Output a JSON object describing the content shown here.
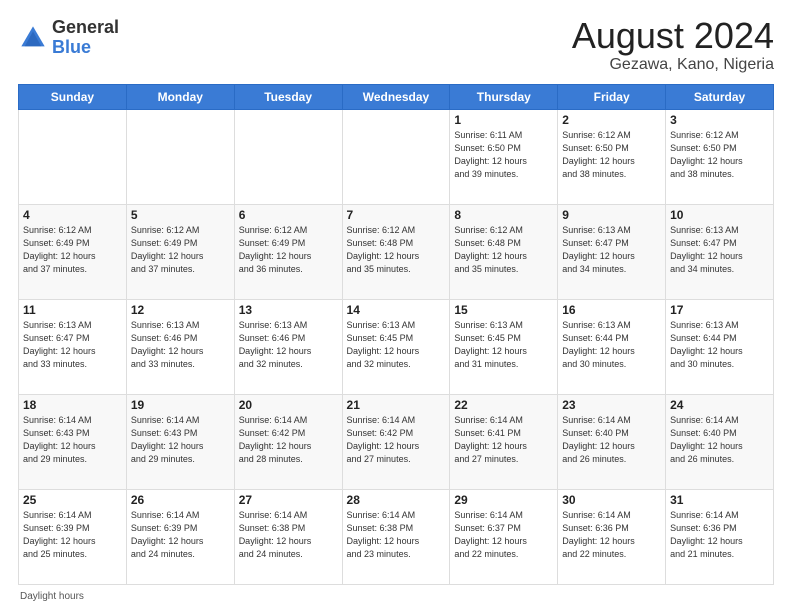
{
  "header": {
    "logo_general": "General",
    "logo_blue": "Blue",
    "month_title": "August 2024",
    "location": "Gezawa, Kano, Nigeria"
  },
  "days_of_week": [
    "Sunday",
    "Monday",
    "Tuesday",
    "Wednesday",
    "Thursday",
    "Friday",
    "Saturday"
  ],
  "footer": {
    "daylight_label": "Daylight hours"
  },
  "weeks": [
    [
      {
        "day": "",
        "info": ""
      },
      {
        "day": "",
        "info": ""
      },
      {
        "day": "",
        "info": ""
      },
      {
        "day": "",
        "info": ""
      },
      {
        "day": "1",
        "info": "Sunrise: 6:11 AM\nSunset: 6:50 PM\nDaylight: 12 hours\nand 39 minutes."
      },
      {
        "day": "2",
        "info": "Sunrise: 6:12 AM\nSunset: 6:50 PM\nDaylight: 12 hours\nand 38 minutes."
      },
      {
        "day": "3",
        "info": "Sunrise: 6:12 AM\nSunset: 6:50 PM\nDaylight: 12 hours\nand 38 minutes."
      }
    ],
    [
      {
        "day": "4",
        "info": "Sunrise: 6:12 AM\nSunset: 6:49 PM\nDaylight: 12 hours\nand 37 minutes."
      },
      {
        "day": "5",
        "info": "Sunrise: 6:12 AM\nSunset: 6:49 PM\nDaylight: 12 hours\nand 37 minutes."
      },
      {
        "day": "6",
        "info": "Sunrise: 6:12 AM\nSunset: 6:49 PM\nDaylight: 12 hours\nand 36 minutes."
      },
      {
        "day": "7",
        "info": "Sunrise: 6:12 AM\nSunset: 6:48 PM\nDaylight: 12 hours\nand 35 minutes."
      },
      {
        "day": "8",
        "info": "Sunrise: 6:12 AM\nSunset: 6:48 PM\nDaylight: 12 hours\nand 35 minutes."
      },
      {
        "day": "9",
        "info": "Sunrise: 6:13 AM\nSunset: 6:47 PM\nDaylight: 12 hours\nand 34 minutes."
      },
      {
        "day": "10",
        "info": "Sunrise: 6:13 AM\nSunset: 6:47 PM\nDaylight: 12 hours\nand 34 minutes."
      }
    ],
    [
      {
        "day": "11",
        "info": "Sunrise: 6:13 AM\nSunset: 6:47 PM\nDaylight: 12 hours\nand 33 minutes."
      },
      {
        "day": "12",
        "info": "Sunrise: 6:13 AM\nSunset: 6:46 PM\nDaylight: 12 hours\nand 33 minutes."
      },
      {
        "day": "13",
        "info": "Sunrise: 6:13 AM\nSunset: 6:46 PM\nDaylight: 12 hours\nand 32 minutes."
      },
      {
        "day": "14",
        "info": "Sunrise: 6:13 AM\nSunset: 6:45 PM\nDaylight: 12 hours\nand 32 minutes."
      },
      {
        "day": "15",
        "info": "Sunrise: 6:13 AM\nSunset: 6:45 PM\nDaylight: 12 hours\nand 31 minutes."
      },
      {
        "day": "16",
        "info": "Sunrise: 6:13 AM\nSunset: 6:44 PM\nDaylight: 12 hours\nand 30 minutes."
      },
      {
        "day": "17",
        "info": "Sunrise: 6:13 AM\nSunset: 6:44 PM\nDaylight: 12 hours\nand 30 minutes."
      }
    ],
    [
      {
        "day": "18",
        "info": "Sunrise: 6:14 AM\nSunset: 6:43 PM\nDaylight: 12 hours\nand 29 minutes."
      },
      {
        "day": "19",
        "info": "Sunrise: 6:14 AM\nSunset: 6:43 PM\nDaylight: 12 hours\nand 29 minutes."
      },
      {
        "day": "20",
        "info": "Sunrise: 6:14 AM\nSunset: 6:42 PM\nDaylight: 12 hours\nand 28 minutes."
      },
      {
        "day": "21",
        "info": "Sunrise: 6:14 AM\nSunset: 6:42 PM\nDaylight: 12 hours\nand 27 minutes."
      },
      {
        "day": "22",
        "info": "Sunrise: 6:14 AM\nSunset: 6:41 PM\nDaylight: 12 hours\nand 27 minutes."
      },
      {
        "day": "23",
        "info": "Sunrise: 6:14 AM\nSunset: 6:40 PM\nDaylight: 12 hours\nand 26 minutes."
      },
      {
        "day": "24",
        "info": "Sunrise: 6:14 AM\nSunset: 6:40 PM\nDaylight: 12 hours\nand 26 minutes."
      }
    ],
    [
      {
        "day": "25",
        "info": "Sunrise: 6:14 AM\nSunset: 6:39 PM\nDaylight: 12 hours\nand 25 minutes."
      },
      {
        "day": "26",
        "info": "Sunrise: 6:14 AM\nSunset: 6:39 PM\nDaylight: 12 hours\nand 24 minutes."
      },
      {
        "day": "27",
        "info": "Sunrise: 6:14 AM\nSunset: 6:38 PM\nDaylight: 12 hours\nand 24 minutes."
      },
      {
        "day": "28",
        "info": "Sunrise: 6:14 AM\nSunset: 6:38 PM\nDaylight: 12 hours\nand 23 minutes."
      },
      {
        "day": "29",
        "info": "Sunrise: 6:14 AM\nSunset: 6:37 PM\nDaylight: 12 hours\nand 22 minutes."
      },
      {
        "day": "30",
        "info": "Sunrise: 6:14 AM\nSunset: 6:36 PM\nDaylight: 12 hours\nand 22 minutes."
      },
      {
        "day": "31",
        "info": "Sunrise: 6:14 AM\nSunset: 6:36 PM\nDaylight: 12 hours\nand 21 minutes."
      }
    ]
  ]
}
